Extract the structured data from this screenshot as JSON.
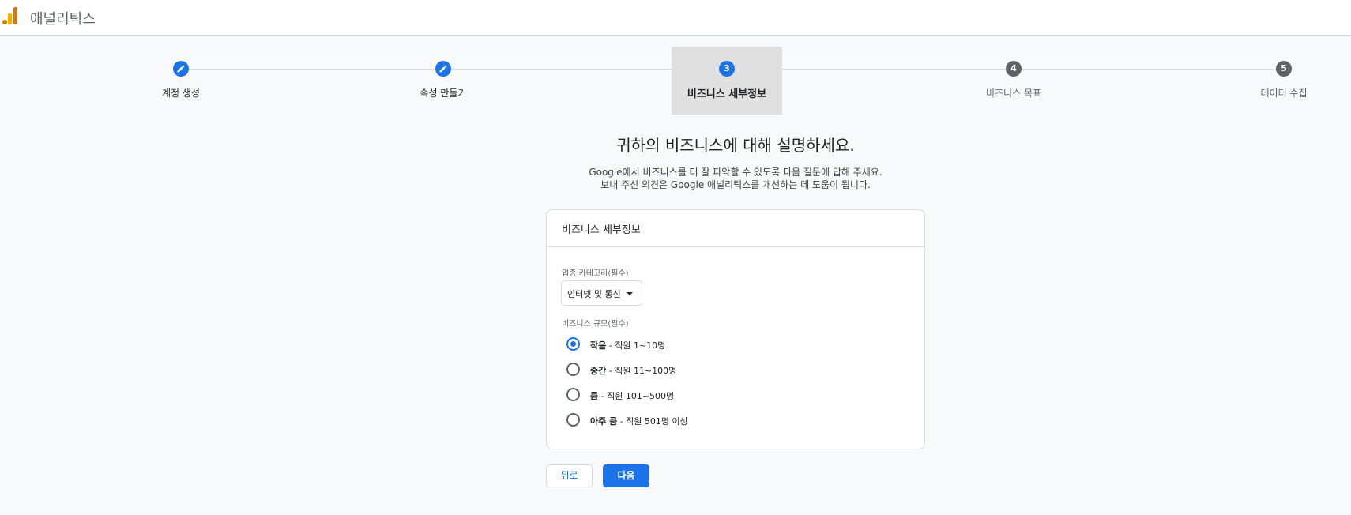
{
  "app": {
    "title": "애널리틱스"
  },
  "stepper": {
    "steps": [
      {
        "number": "1",
        "label": "계정 생성",
        "state": "done",
        "icon": "pencil-icon"
      },
      {
        "number": "2",
        "label": "속성 만들기",
        "state": "done",
        "icon": "pencil-icon"
      },
      {
        "number": "3",
        "label": "비즈니스 세부정보",
        "state": "current"
      },
      {
        "number": "4",
        "label": "비즈니스 목표",
        "state": "todo"
      },
      {
        "number": "5",
        "label": "데이터 수집",
        "state": "todo"
      }
    ]
  },
  "page": {
    "heading": "귀하의 비즈니스에 대해 설명하세요.",
    "sub1": "Google에서 비즈니스를 더 잘 파악할 수 있도록 다음 질문에 답해 주세요.",
    "sub2": "보내 주신 의견은 Google 애널리틱스를 개선하는 데 도움이 됩니다."
  },
  "card": {
    "title": "비즈니스 세부정보",
    "industry_label": "업종 카테고리(필수)",
    "industry_value": "인터넷 및 통신",
    "size_label": "비즈니스 규모(필수)",
    "size_options": [
      {
        "bold": "작음",
        "rest": " - 직원 1~10명",
        "checked": true
      },
      {
        "bold": "중간",
        "rest": " - 직원 11~100명",
        "checked": false
      },
      {
        "bold": "큼",
        "rest": " - 직원 101~500명",
        "checked": false
      },
      {
        "bold": "아주 큼",
        "rest": " - 직원 501명 이상",
        "checked": false
      }
    ]
  },
  "buttons": {
    "back": "뒤로",
    "next": "다음"
  },
  "colors": {
    "accent": "#1a73e8",
    "logo_orange": "#e37400",
    "logo_yellow": "#f9ab00"
  }
}
